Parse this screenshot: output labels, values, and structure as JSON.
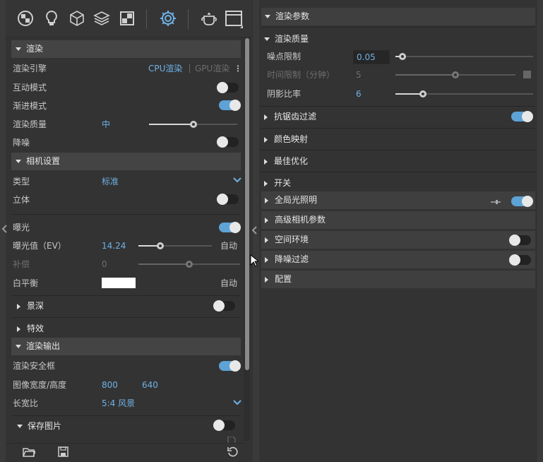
{
  "left_panel": {
    "sections": {
      "render": "渲染",
      "camera": "相机设置",
      "dof": "景深",
      "effects": "特效",
      "output": "渲染输出",
      "save_image": "保存图片"
    },
    "render_engine": {
      "label": "渲染引擎",
      "cpu": "CPU渲染",
      "gpu": "GPU渲染"
    },
    "interactive": {
      "label": "互动模式",
      "on": false
    },
    "progressive": {
      "label": "渐进模式",
      "on": true
    },
    "quality": {
      "label": "渲染质量",
      "value": "中",
      "level": 0.5
    },
    "denoise": {
      "label": "降噪",
      "on": false
    },
    "cam_type": {
      "label": "类型",
      "value": "标准"
    },
    "stereo": {
      "label": "立体",
      "on": false
    },
    "exposure": {
      "label": "曝光",
      "on": true
    },
    "exposure_value": {
      "label": "曝光值（EV）",
      "value": "14.24",
      "auto": "自动",
      "level": 0.3
    },
    "compensation": {
      "label": "补偿",
      "value": "0",
      "level": 0.5
    },
    "white_balance": {
      "label": "白平衡",
      "auto": "自动",
      "color": "#ffffff"
    },
    "dof_on": false,
    "safe_frame": {
      "label": "渲染安全框",
      "on": true
    },
    "image_size": {
      "label": "图像宽度/高度",
      "width": "800",
      "height": "640"
    },
    "aspect": {
      "label": "长宽比",
      "value": "5:4 风景"
    },
    "save_on": false
  },
  "right_panel": {
    "render_params": "渲染参数",
    "render_quality": "渲染质量",
    "noise_limit": {
      "label": "噪点限制",
      "value": "0.05",
      "level": 0.05
    },
    "time_limit": {
      "label": "时间限制（分钟）",
      "value": "5",
      "level": 0.5
    },
    "shadow_ratio": {
      "label": "阴影比率",
      "value": "6",
      "level": 0.2
    },
    "antialias": {
      "label": "抗锯齿过滤",
      "on": true
    },
    "color_mapping": "颜色映射",
    "optimization": "最佳优化",
    "switch": "开关",
    "gi": {
      "label": "全局光照明",
      "on": true
    },
    "advanced_camera": "高级相机参数",
    "ambient": {
      "label": "空间环境",
      "on": false
    },
    "denoise_filter": {
      "label": "降噪过滤",
      "on": false
    },
    "config": "配置"
  },
  "icons": [
    "material-ball-icon",
    "light-bulb-icon",
    "cube-icon",
    "layers-icon",
    "texture-icon",
    "settings-gear-icon",
    "teapot-icon",
    "render-window-icon",
    "folder-open-icon",
    "save-icon",
    "reset-icon",
    "file-icon",
    "more-vertical-icon",
    "collapse-left-icon",
    "collapse-right-icon",
    "pin-icon"
  ],
  "colors": {
    "accent": "#6fb1e6",
    "toggle_on": "#5ea2d6",
    "panel_bg": "#333333",
    "section_bg": "#444444"
  }
}
